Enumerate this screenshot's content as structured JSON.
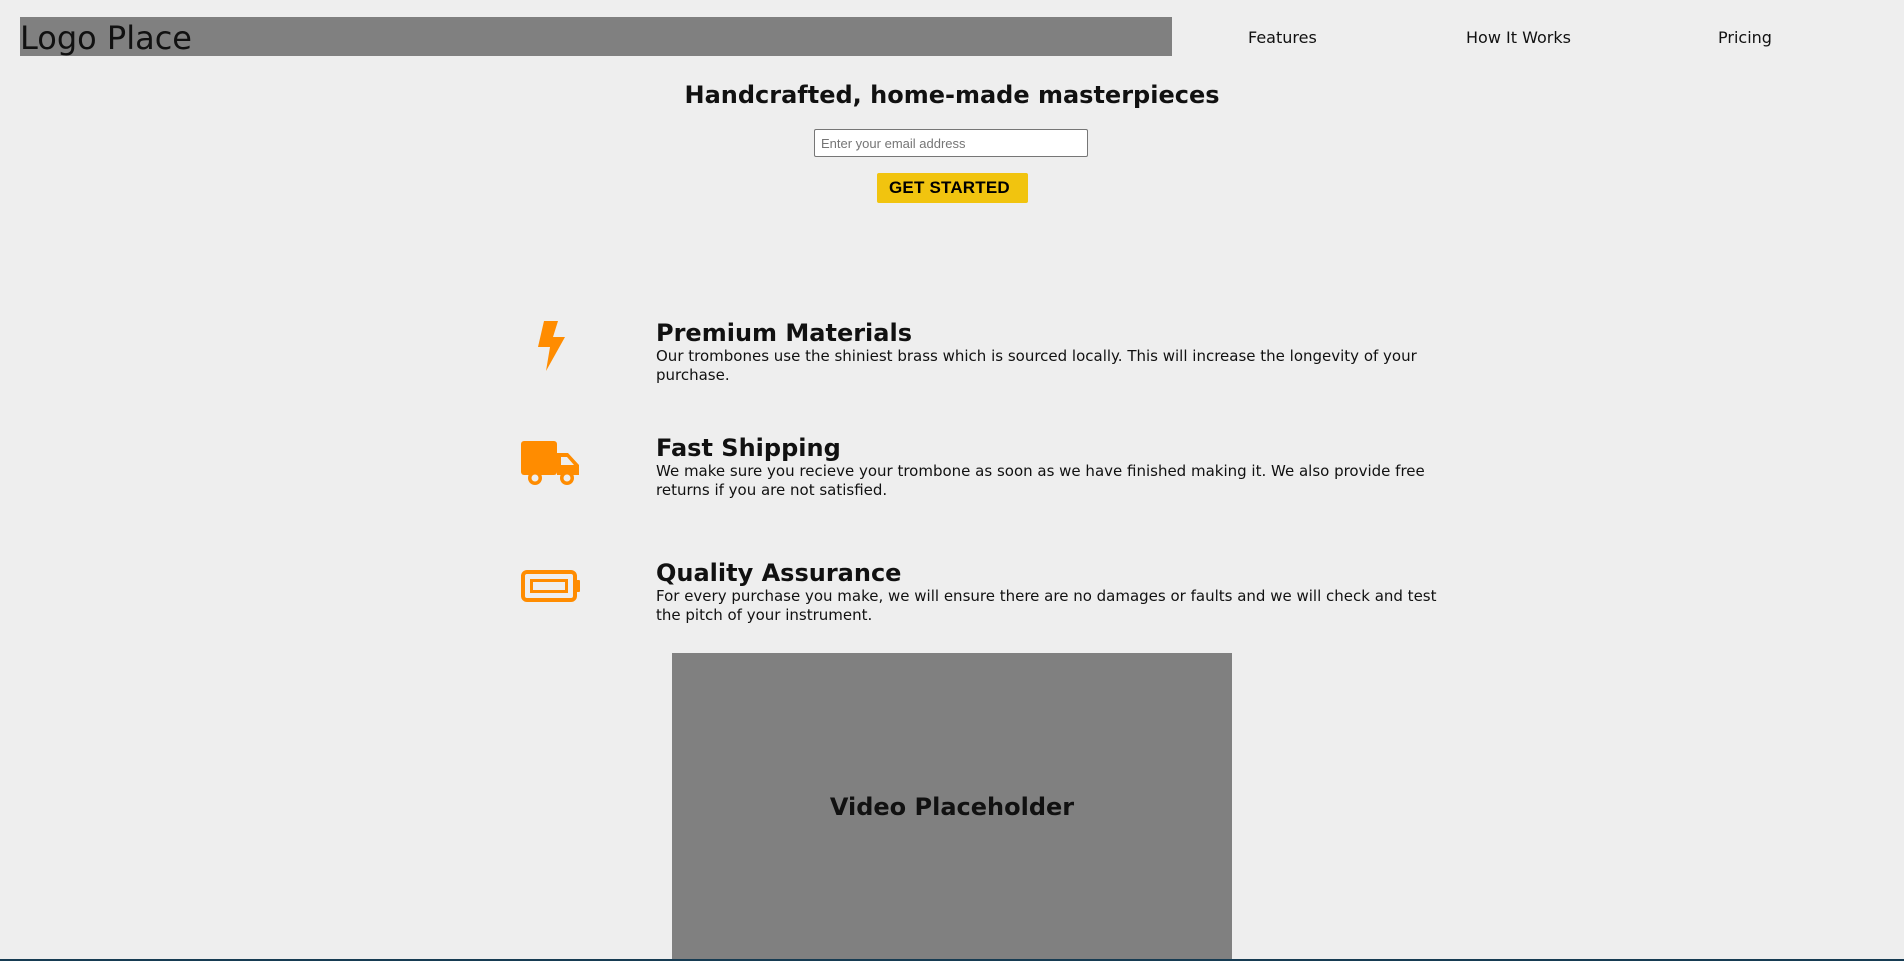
{
  "header": {
    "logo_text": "Logo Place",
    "nav": {
      "features": "Features",
      "how_it_works": "How It Works",
      "pricing": "Pricing"
    }
  },
  "hero": {
    "title": "Handcrafted, home-made masterpieces",
    "email_placeholder": "Enter your email address",
    "cta_label": "GET STARTED"
  },
  "features": [
    {
      "icon": "lightning-icon",
      "title": "Premium Materials",
      "description": "Our trombones use the shiniest brass which is sourced locally. This will increase the longevity of your purchase."
    },
    {
      "icon": "truck-icon",
      "title": "Fast Shipping",
      "description": "We make sure you recieve your trombone as soon as we have finished making it. We also provide free returns if you are not satisfied."
    },
    {
      "icon": "battery-icon",
      "title": "Quality Assurance",
      "description": "For every purchase you make, we will ensure there are no damages or faults and we will check and test the pitch of your instrument."
    }
  ],
  "video": {
    "label": "Video Placeholder"
  },
  "colors": {
    "background": "#eeeeee",
    "placeholder_gray": "#808080",
    "accent_orange": "#ff8c00",
    "cta_yellow": "#f1c40f"
  }
}
